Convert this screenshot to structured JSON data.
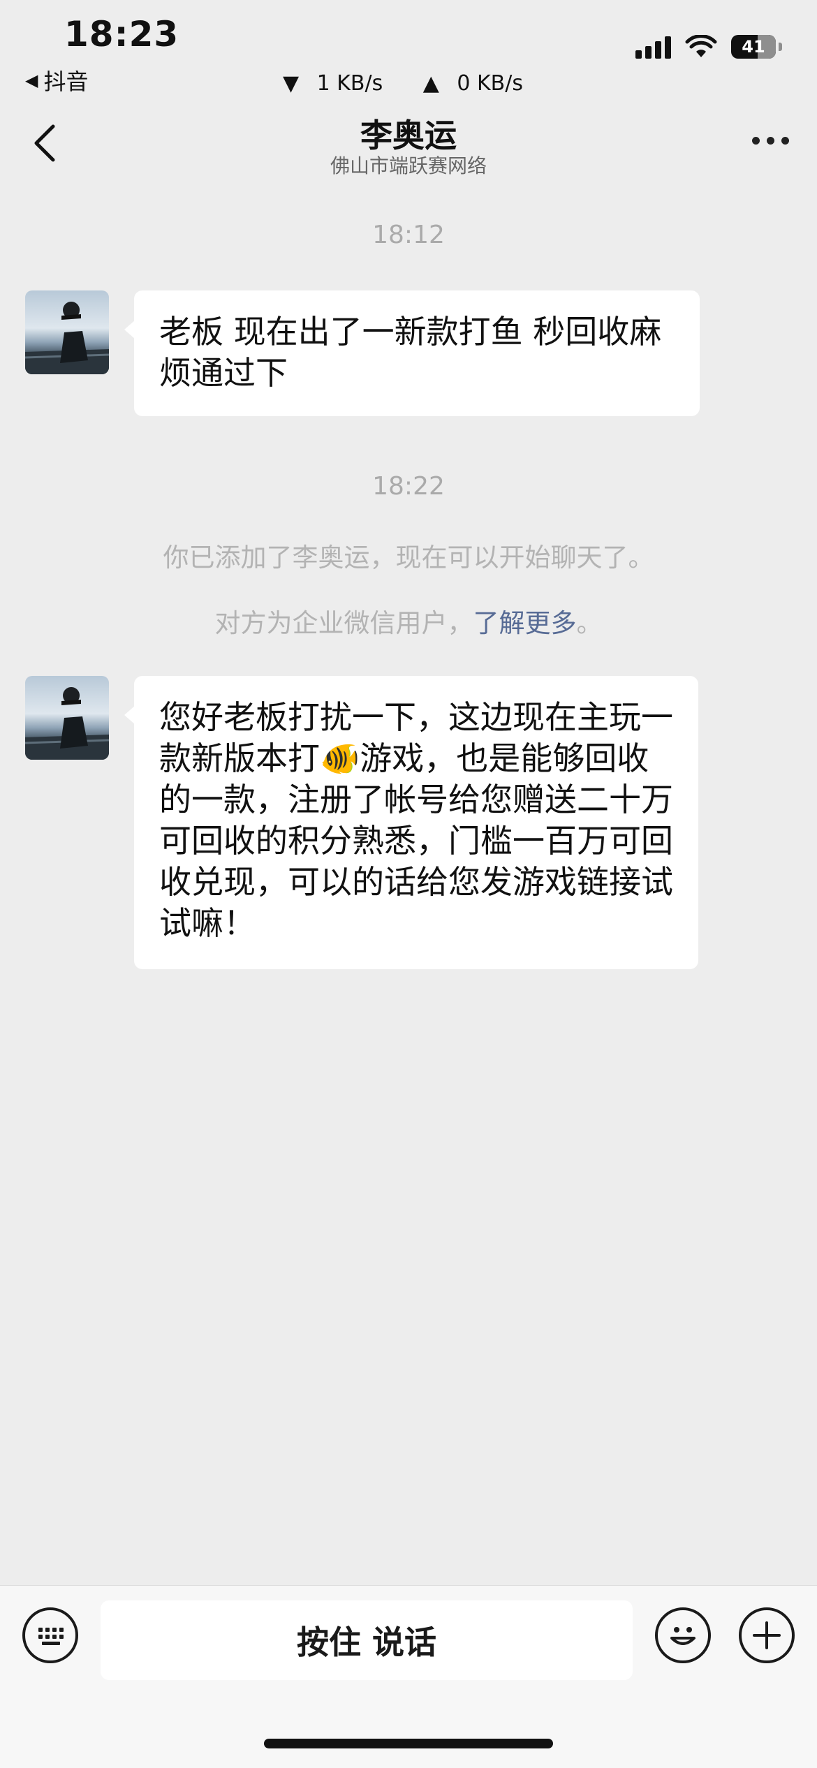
{
  "status_bar": {
    "time": "18:23",
    "back_app": "抖音",
    "download_speed": "1 KB/s",
    "upload_speed": "0 KB/s",
    "battery_level": "41"
  },
  "header": {
    "title": "李奥运",
    "subtitle": "佛山市端跃赛网络"
  },
  "messages": [
    {
      "time_label": "18:12",
      "text": "老板 现在出了一新款打鱼  秒回收麻烦通过下"
    },
    {
      "time_label": "18:22",
      "system_added": "你已添加了李奥运，现在可以开始聊天了。",
      "system_enterprise_prefix": "对方为企业微信用户，",
      "system_enterprise_link": "了解更多",
      "system_enterprise_suffix": "。",
      "text_part1": "您好老板打扰一下，这边现在主玩一款新版本打",
      "emoji": "🐠",
      "text_part2": "游戏，也是能够回收的一款，注册了帐号给您赠送二十万可回收的积分熟悉，门槛一百万可回收兑现，可以的话给您发游戏链接试试嘛！"
    }
  ],
  "input_bar": {
    "voice_button_label": "按住 说话"
  }
}
